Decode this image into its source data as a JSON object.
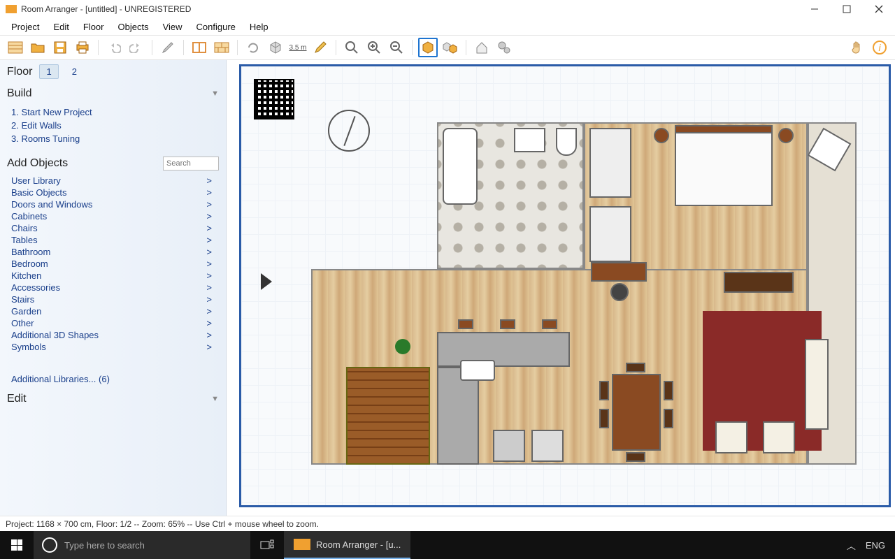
{
  "titlebar": {
    "text": "Room Arranger - [untitled] - UNREGISTERED"
  },
  "menu": {
    "items": [
      "Project",
      "Edit",
      "Floor",
      "Objects",
      "View",
      "Configure",
      "Help"
    ]
  },
  "toolbar": {
    "measure_label": "3.5 m"
  },
  "sidebar": {
    "floor_label": "Floor",
    "floors": [
      "1",
      "2"
    ],
    "active_floor": 0,
    "build_header": "Build",
    "build_items": [
      "1. Start New Project",
      "2. Edit Walls",
      "3. Rooms Tuning"
    ],
    "add_objects_header": "Add Objects",
    "search_placeholder": "Search",
    "categories": [
      "User Library",
      "Basic Objects",
      "Doors and Windows",
      "Cabinets",
      "Chairs",
      "Tables",
      "Bathroom",
      "Bedroom",
      "Kitchen",
      "Accessories",
      "Stairs",
      "Garden",
      "Other",
      "Additional 3D Shapes",
      "Symbols"
    ],
    "additional_libs": "Additional Libraries... (6)",
    "edit_header": "Edit"
  },
  "status": {
    "text": "Project: 1168 × 700 cm, Floor: 1/2 -- Zoom: 65% -- Use Ctrl + mouse wheel to zoom."
  },
  "taskbar": {
    "search_placeholder": "Type here to search",
    "app_label": "Room Arranger - [u...",
    "lang": "ENG"
  }
}
